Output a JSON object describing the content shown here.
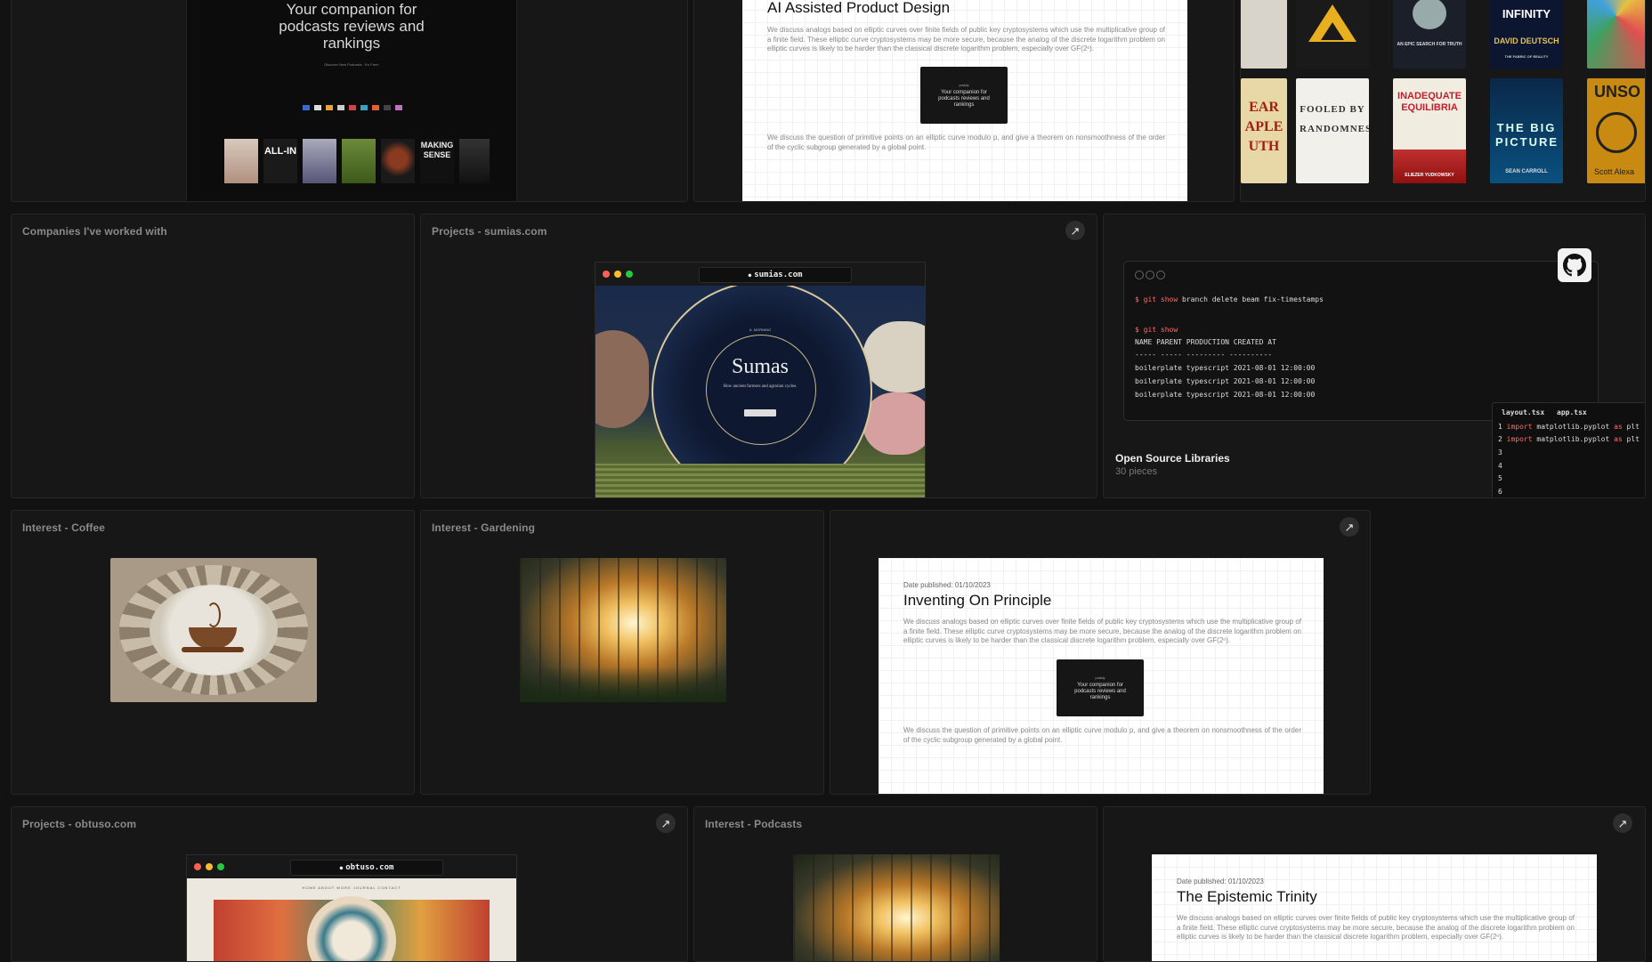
{
  "podcast_card": {
    "headline": "Your companion for podcasts reviews and rankings",
    "tiny_line": "Discover New Podcasts · It's Free!",
    "tiles": [
      {
        "name": "ALL-IN"
      },
      {
        "name": "GOVERNMENT LAB"
      },
      {
        "name": "THE JOE ROGAN EXPERIENCE"
      },
      {
        "name": "MAKING SENSE"
      }
    ]
  },
  "ai_article": {
    "title": "AI Assisted Product Design",
    "paragraph1": "We discuss analogs based on elliptic curves over finite fields of public key cryptosystems which use the multiplicative group of a finite field. These elliptic curve cryptosystems may be more secure, because the analog of the discrete logarithm problem on elliptic curves is likely to be harder than the classical discrete logarithm problem, especially over GF(2ⁿ).",
    "paragraph2": "We discuss the question of primitive points on an elliptic curve modulo p, and give a theorem on nonsmoothness of the order of the cyclic subgroup generated by a global point.",
    "thumb_brand": "poddy",
    "thumb_text": "Your companion for podcasts reviews and rankings"
  },
  "books": [
    {
      "title": "INFINITY",
      "author": "DAVID DEUTSCH",
      "sub": "THE FABRIC OF REALITY"
    },
    {
      "title": "FOOLED BY RANDOMNESS"
    },
    {
      "title": "INADEQUATE EQUILIBRIA",
      "author": "ELIEZER YUDKOWSKY"
    },
    {
      "title": "THE BIG PICTURE",
      "author": "SEAN CARROLL"
    },
    {
      "title": "UNSO",
      "author": "Scott Alexa"
    },
    {
      "title": "EAR APLE UTH"
    },
    {
      "title": "AN EPIC SEARCH FOR TRUTH"
    }
  ],
  "companies": {
    "label": "Companies I've worked with"
  },
  "sumias": {
    "label": "Projects - sumias.com",
    "url": "sumias.com",
    "site_title": "Sumas",
    "site_tagline": "How ancient farmers and agrarian cycles.",
    "tag_small": "A. MORNING"
  },
  "opensource": {
    "label": "Open Source Libraries",
    "count": "30 pieces",
    "term_lines": [
      {
        "prompt": "$ git show",
        "rest": " branch delete beam fix-timestamps"
      },
      {
        "prompt": "$ git show",
        "rest": ""
      },
      {
        "prompt": "",
        "rest": "NAME PARENT PRODUCTION CREATED AT"
      },
      {
        "prompt": "",
        "rest": "----- ----- --------- ----------"
      },
      {
        "prompt": "",
        "rest": "boilerplate typescript 2021-08-01 12:00:00"
      },
      {
        "prompt": "",
        "rest": "boilerplate typescript 2021-08-01 12:00:00"
      },
      {
        "prompt": "",
        "rest": "boilerplate typescript 2021-08-01 12:00:00"
      }
    ],
    "code_tabs": [
      "layout.tsx",
      "app.tsx"
    ],
    "code_lines": [
      {
        "num": "1",
        "kw": "import",
        "rest": " matplotlib.pyplot ",
        "kw2": "as",
        "rest2": " plt"
      },
      {
        "num": "2",
        "kw": "import",
        "rest": " matplotlib.pyplot ",
        "kw2": "as",
        "rest2": " plt"
      },
      {
        "num": "3",
        "kw": "",
        "rest": "",
        "kw2": "",
        "rest2": ""
      },
      {
        "num": "4",
        "kw": "",
        "rest": "",
        "kw2": "",
        "rest2": ""
      },
      {
        "num": "5",
        "kw": "",
        "rest": "",
        "kw2": "",
        "rest2": ""
      },
      {
        "num": "6",
        "kw": "",
        "rest": "",
        "kw2": "",
        "rest2": ""
      }
    ]
  },
  "coffee": {
    "label": "Interest - Coffee"
  },
  "gardening": {
    "label": "Interest - Gardening"
  },
  "inventing": {
    "date": "Date published: 01/10/2023",
    "title": "Inventing On Principle",
    "paragraph1": "We discuss analogs based on elliptic curves over finite fields of public key cryptosystems which use the multiplicative group of a finite field. These elliptic curve cryptosystems may be more secure, because the analog of the discrete logarithm problem on elliptic curves is likely to be harder than the classical discrete logarithm problem, especially over GF(2ⁿ).",
    "paragraph2": "We discuss the question of primitive points on an elliptic curve modulo p, and give a theorem on nonsmoothness of the order of the cyclic subgroup generated by a global point.",
    "thumb_brand": "poddy",
    "thumb_text": "Your companion for podcasts reviews and rankings"
  },
  "obtuso": {
    "label": "Projects - obtuso.com",
    "url": "obtuso.com",
    "nav": "HOME   ABOUT   WORK   JOURNAL   CONTACT"
  },
  "podcasts": {
    "label": "Interest - Podcasts"
  },
  "epistemic": {
    "date": "Date published: 01/10/2023",
    "title": "The Epistemic Trinity",
    "paragraph1": "We discuss analogs based on elliptic curves over finite fields of public key cryptosystems which use the multiplicative group of a finite field. These elliptic curve cryptosystems may be more secure, because the analog of the discrete logarithm problem on elliptic curves is likely to be harder than the classical discrete logarithm problem, especially over GF(2ⁿ)."
  },
  "icons": {
    "arrow": "↗",
    "lock": "🔒",
    "github": "github-icon"
  },
  "colors": {
    "background": "#121212",
    "card": "#171717",
    "dot_red": "#ff5f57",
    "dot_yellow": "#febc2e",
    "dot_green": "#28c840"
  }
}
